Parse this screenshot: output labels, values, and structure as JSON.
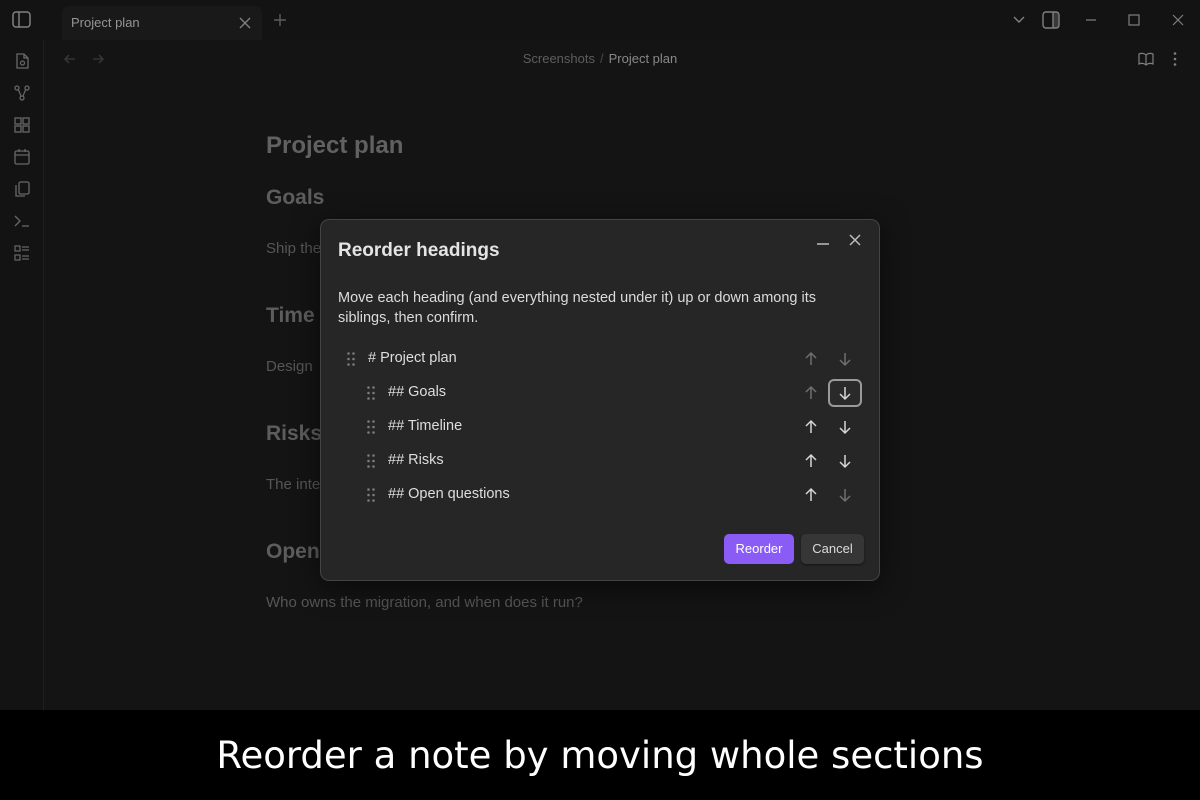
{
  "window": {
    "tab_title": "Project plan"
  },
  "breadcrumb": {
    "folder": "Screenshots",
    "separator": "/",
    "file": "Project plan"
  },
  "document": {
    "title": "Project plan",
    "sections": [
      {
        "heading": "Goals",
        "body": "Ship the"
      },
      {
        "heading": "Time",
        "body": "Design"
      },
      {
        "heading": "Risks",
        "body": "The inte"
      },
      {
        "heading": "Open",
        "body": "Who owns the migration, and when does it run?"
      }
    ]
  },
  "modal": {
    "title": "Reorder headings",
    "description": "Move each heading (and everything nested under it) up or down among its siblings, then confirm.",
    "headings": [
      {
        "label": "# Project plan",
        "level": 1,
        "up_enabled": false,
        "down_enabled": false,
        "focused": null
      },
      {
        "label": "## Goals",
        "level": 2,
        "up_enabled": false,
        "down_enabled": true,
        "focused": "down"
      },
      {
        "label": "## Timeline",
        "level": 2,
        "up_enabled": true,
        "down_enabled": true,
        "focused": null
      },
      {
        "label": "## Risks",
        "level": 2,
        "up_enabled": true,
        "down_enabled": true,
        "focused": null
      },
      {
        "label": "## Open questions",
        "level": 2,
        "up_enabled": true,
        "down_enabled": false,
        "focused": null
      }
    ],
    "confirm_label": "Reorder",
    "cancel_label": "Cancel"
  },
  "caption": "Reorder a note by moving whole sections",
  "colors": {
    "accent": "#8a5cf5",
    "background": "#1e1e1e",
    "modal_background": "#262626"
  },
  "icons": {
    "ribbon": [
      "new-note-icon",
      "graph-view-icon",
      "canvas-icon",
      "daily-note-icon",
      "templates-icon",
      "command-palette-icon",
      "outline-icon"
    ]
  }
}
